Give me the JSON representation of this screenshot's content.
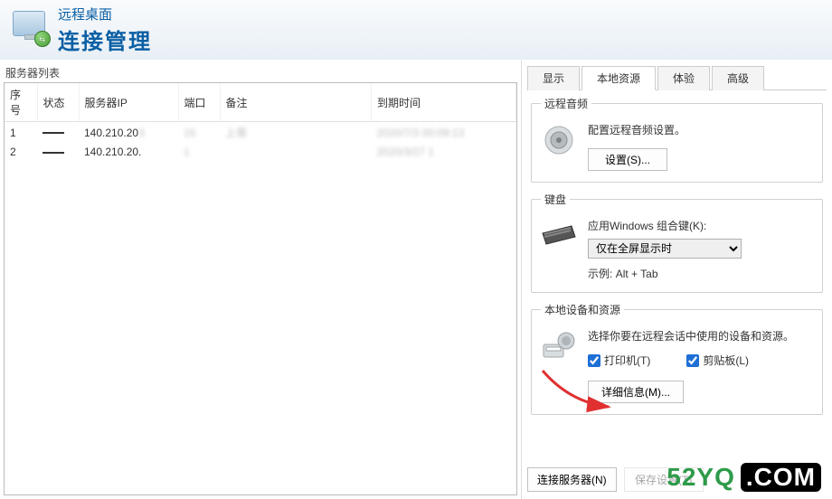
{
  "header": {
    "line1": "远程桌面",
    "line2": "连接管理"
  },
  "left": {
    "title": "服务器列表",
    "columns": [
      "序号",
      "状态",
      "服务器IP",
      "端口",
      "备注",
      "到期时间"
    ],
    "rows": [
      {
        "idx": "1",
        "status": "—",
        "ip": "140.210.20",
        "ip_obscured": "3",
        "port": "15",
        "note": "上哥",
        "expire": "2020/7/3 00:09:13"
      },
      {
        "idx": "2",
        "status": "—",
        "ip": "140.210.20.",
        "ip_obscured": "",
        "port": "1",
        "note": "",
        "expire": "2020/3/27 1"
      }
    ]
  },
  "tabs": {
    "items": [
      "显示",
      "本地资源",
      "体验",
      "高级"
    ],
    "active": 1
  },
  "audio": {
    "legend": "远程音频",
    "desc": "配置远程音频设置。",
    "button": "设置(S)..."
  },
  "keyboard": {
    "legend": "键盘",
    "desc": "应用Windows 组合键(K):",
    "select_value": "仅在全屏显示时",
    "example_label": "示例:",
    "example_value": "Alt + Tab"
  },
  "devices": {
    "legend": "本地设备和资源",
    "desc": "选择你要在远程会话中使用的设备和资源。",
    "printer_label": "打印机(T)",
    "clipboard_label": "剪贴板(L)",
    "printer_checked": true,
    "clipboard_checked": true,
    "button": "详细信息(M)..."
  },
  "footer": {
    "connect": "连接服务器(N)",
    "save": "保存设置(T)"
  },
  "watermark": {
    "p1": "52YQ",
    "p2": ".COM"
  }
}
